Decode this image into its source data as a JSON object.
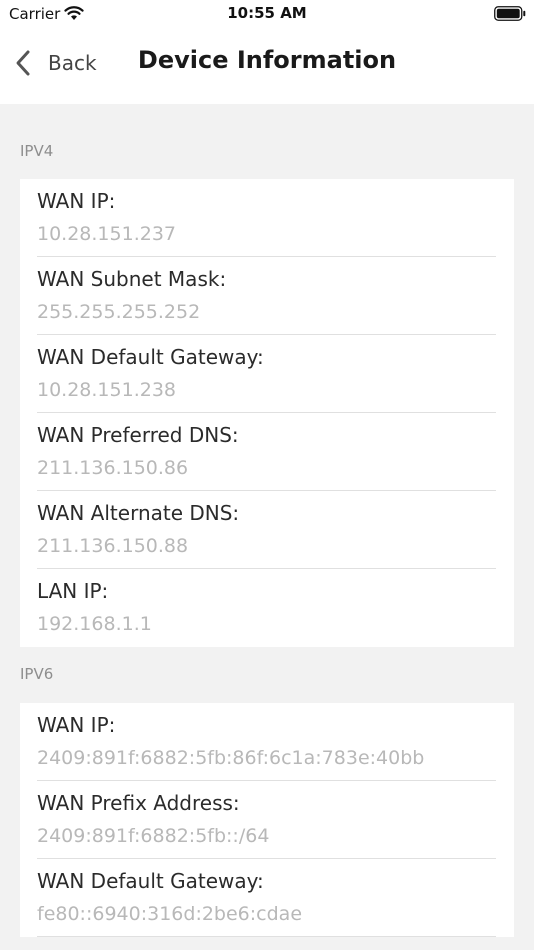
{
  "status_bar": {
    "carrier": "Carrier",
    "time": "10:55 AM"
  },
  "nav": {
    "back_label": "Back",
    "title": "Device Information"
  },
  "sections": [
    {
      "header": "IPV4",
      "rows": [
        {
          "label": "WAN IP:",
          "value": "10.28.151.237"
        },
        {
          "label": "WAN Subnet Mask:",
          "value": "255.255.255.252"
        },
        {
          "label": "WAN Default Gateway:",
          "value": "10.28.151.238"
        },
        {
          "label": "WAN Preferred DNS:",
          "value": "211.136.150.86"
        },
        {
          "label": "WAN Alternate DNS:",
          "value": "211.136.150.88"
        },
        {
          "label": "LAN IP:",
          "value": "192.168.1.1"
        }
      ]
    },
    {
      "header": "IPV6",
      "rows": [
        {
          "label": "WAN IP:",
          "value": "2409:891f:6882:5fb:86f:6c1a:783e:40bb"
        },
        {
          "label": "WAN Prefix Address:",
          "value": "2409:891f:6882:5fb::/64"
        },
        {
          "label": "WAN Default Gateway:",
          "value": "fe80::6940:316d:2be6:cdae"
        }
      ]
    }
  ]
}
